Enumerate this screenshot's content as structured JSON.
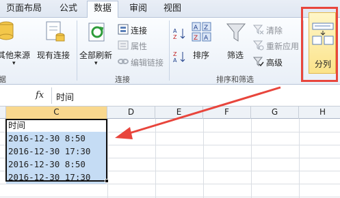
{
  "tabs": [
    "页面布局",
    "公式",
    "数据",
    "审阅",
    "视图"
  ],
  "ribbon": {
    "other_sources": "其他来源",
    "existing_connections": "现有连接",
    "refresh_all": "全部刷新",
    "connections": "连接",
    "properties": "属性",
    "edit_links": "编辑链接",
    "sort": "排序",
    "filter": "筛选",
    "clear": "清除",
    "reapply": "重新应用",
    "advanced": "高级",
    "text_to_columns": "分列",
    "group_partial": "据",
    "group_connections": "连接",
    "group_sort_filter": "排序和筛选"
  },
  "formula_bar": {
    "fx": "fx",
    "value": "时间"
  },
  "columns": [
    "C",
    "D",
    "E",
    "F",
    "G",
    "H"
  ],
  "cells": [
    "时间",
    "2016-12-30  8:50",
    "2016-12-30  17:30",
    "2016-12-30  8:50",
    "2016-12-30  17:30"
  ],
  "colors": {
    "highlight_box": "#e8453c",
    "selection_fill": "#c5dcf4",
    "arrow": "#e8453c"
  }
}
